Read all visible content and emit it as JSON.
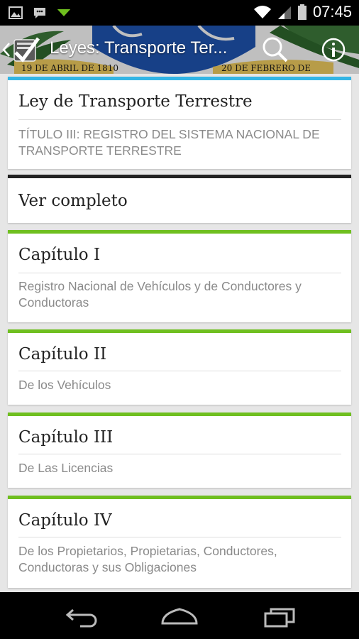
{
  "status_bar": {
    "time": "07:45",
    "icons": [
      "image-icon",
      "chat-icon",
      "download-icon",
      "wifi-icon",
      "signal-icon",
      "battery-icon"
    ]
  },
  "action_bar": {
    "title": "Leyes: Transporte Ter...",
    "icons": [
      "up-icon",
      "app-logo-icon",
      "search-icon",
      "info-icon"
    ],
    "banner_texts": [
      "19 DE ABRIL DE 1810",
      "20 DE FEBRERO DE"
    ]
  },
  "header_card": {
    "title": "Ley de Transporte Terrestre",
    "subtitle": "TÍTULO III: REGISTRO DEL SISTEMA NACIONAL DE TRANSPORTE TERRESTRE",
    "accent": "#33b5e5"
  },
  "view_all": {
    "label": "Ver completo",
    "accent": "#222222"
  },
  "chapters": [
    {
      "title": "Capítulo I",
      "subtitle": "Registro Nacional de Vehículos y de Conductores y Conductoras"
    },
    {
      "title": "Capítulo II",
      "subtitle": "De los Vehículos"
    },
    {
      "title": "Capítulo III",
      "subtitle": "De Las Licencias"
    },
    {
      "title": "Capítulo IV",
      "subtitle": "De los Propietarios, Propietarias, Conductores, Conductoras y sus Obligaciones"
    }
  ],
  "chapter_accent": "#6fbf1f",
  "nav_bar": {
    "icons": [
      "back-icon",
      "home-icon",
      "recents-icon"
    ]
  }
}
